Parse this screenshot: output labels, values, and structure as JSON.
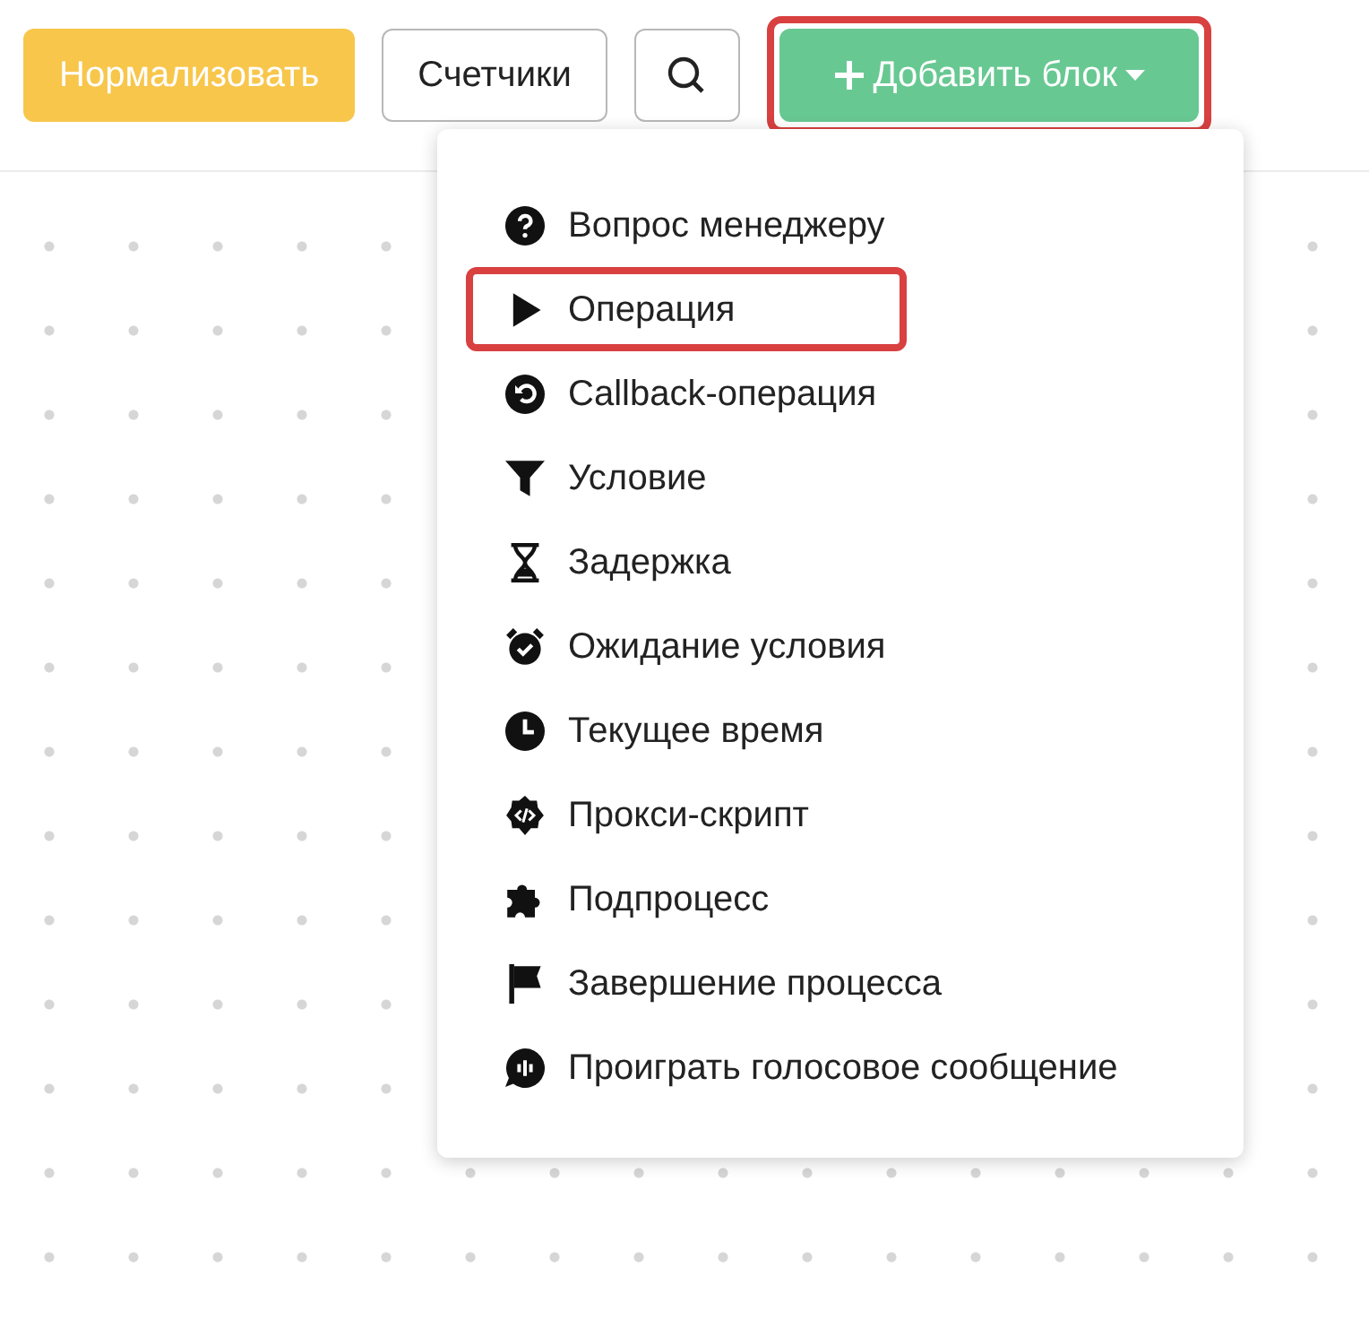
{
  "toolbar": {
    "buttons": [
      {
        "kind": "warning",
        "label": "Нормализовать"
      },
      {
        "kind": "outline",
        "label": "Счетчики"
      },
      {
        "kind": "search"
      },
      {
        "kind": "add",
        "label": "Добавить блок",
        "highlighted": true,
        "expanded": true
      }
    ]
  },
  "menu": {
    "items": [
      {
        "kind": "question",
        "label": "Вопрос менеджеру",
        "highlighted": false
      },
      {
        "kind": "play",
        "label": "Операция",
        "highlighted": true
      },
      {
        "kind": "undo",
        "label": "Callback-операция",
        "highlighted": false
      },
      {
        "kind": "filter",
        "label": "Условие",
        "highlighted": false
      },
      {
        "kind": "hourglass",
        "label": "Задержка",
        "highlighted": false
      },
      {
        "kind": "alarm",
        "label": "Ожидание условия",
        "highlighted": false
      },
      {
        "kind": "clock",
        "label": "Текущее время",
        "highlighted": false
      },
      {
        "kind": "code",
        "label": "Прокси-скрипт",
        "highlighted": false
      },
      {
        "kind": "puzzle",
        "label": "Подпроцесс",
        "highlighted": false
      },
      {
        "kind": "flag",
        "label": "Завершение процесса",
        "highlighted": false
      },
      {
        "kind": "voice",
        "label": "Проиграть голосовое сообщение",
        "highlighted": false
      }
    ]
  }
}
